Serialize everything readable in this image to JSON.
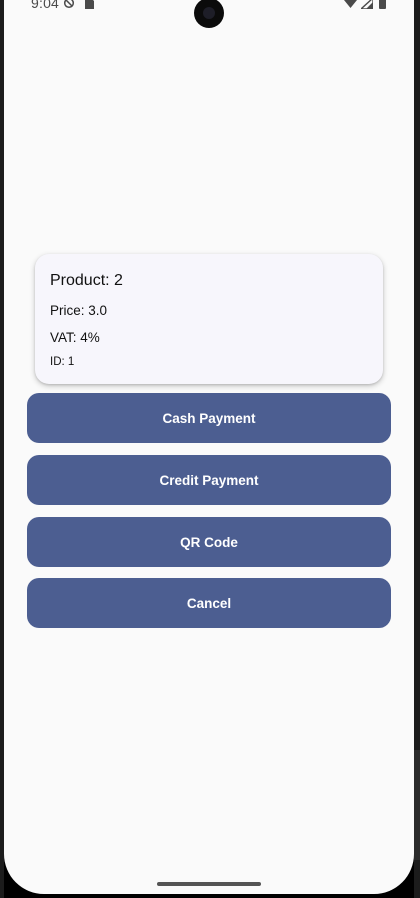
{
  "status_bar": {
    "time": "9:04",
    "icons": [
      "do-not-disturb-icon",
      "sim-card-icon",
      "wifi-icon",
      "signal-icon",
      "battery-icon"
    ]
  },
  "product_card": {
    "title": "Product: 2",
    "price": "Price: 3.0",
    "vat": "VAT: 4%",
    "id": "ID: 1"
  },
  "actions": {
    "cash_label": "Cash Payment",
    "credit_label": "Credit Payment",
    "qr_label": "QR Code",
    "cancel_label": "Cancel"
  },
  "colors": {
    "button_bg": "#4c5e91",
    "button_text": "#ffffff",
    "screen_bg": "#fafafa",
    "card_bg": "#f7f6fc"
  }
}
